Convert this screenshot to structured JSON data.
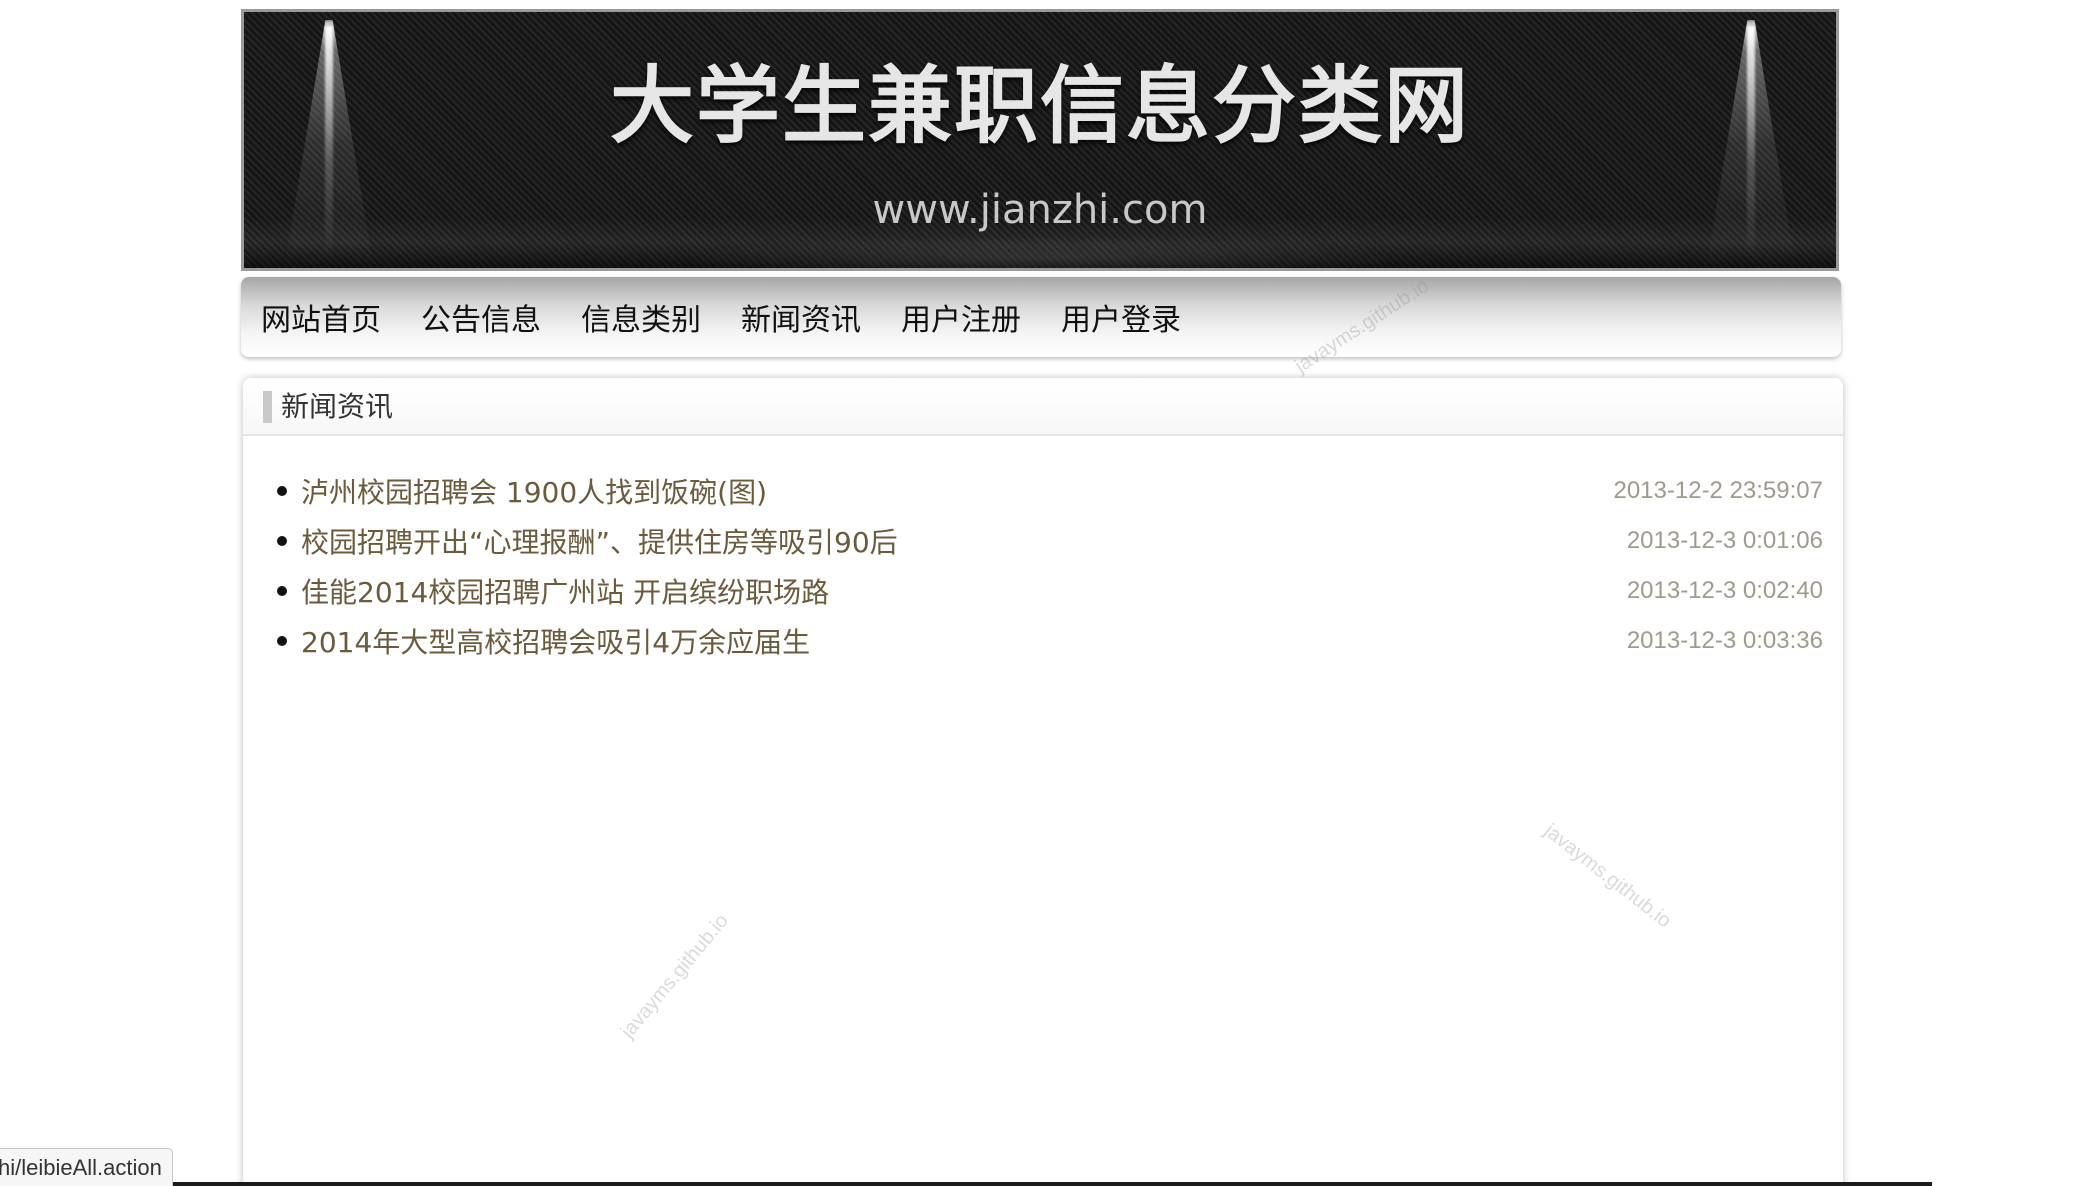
{
  "banner": {
    "title": "大学生兼职信息分类网",
    "url": "www.jianzhi.com"
  },
  "nav": {
    "items": [
      "网站首页",
      "公告信息",
      "信息类别",
      "新闻资讯",
      "用户注册",
      "用户登录"
    ]
  },
  "panel": {
    "title": "新闻资讯",
    "news": [
      {
        "title": "泸州校园招聘会 1900人找到饭碗(图)",
        "date": "2013-12-2 23:59:07"
      },
      {
        "title": "校园招聘开出“心理报酬”、提供住房等吸引90后",
        "date": "2013-12-3 0:01:06"
      },
      {
        "title": "佳能2014校园招聘广州站 开启缤纷职场路",
        "date": "2013-12-3 0:02:40"
      },
      {
        "title": "2014年大型高校招聘会吸引4万余应届生",
        "date": "2013-12-3 0:03:36"
      }
    ]
  },
  "watermark": "javayms.github.io",
  "status_bar": {
    "url": "hi/leibieAll.action"
  }
}
